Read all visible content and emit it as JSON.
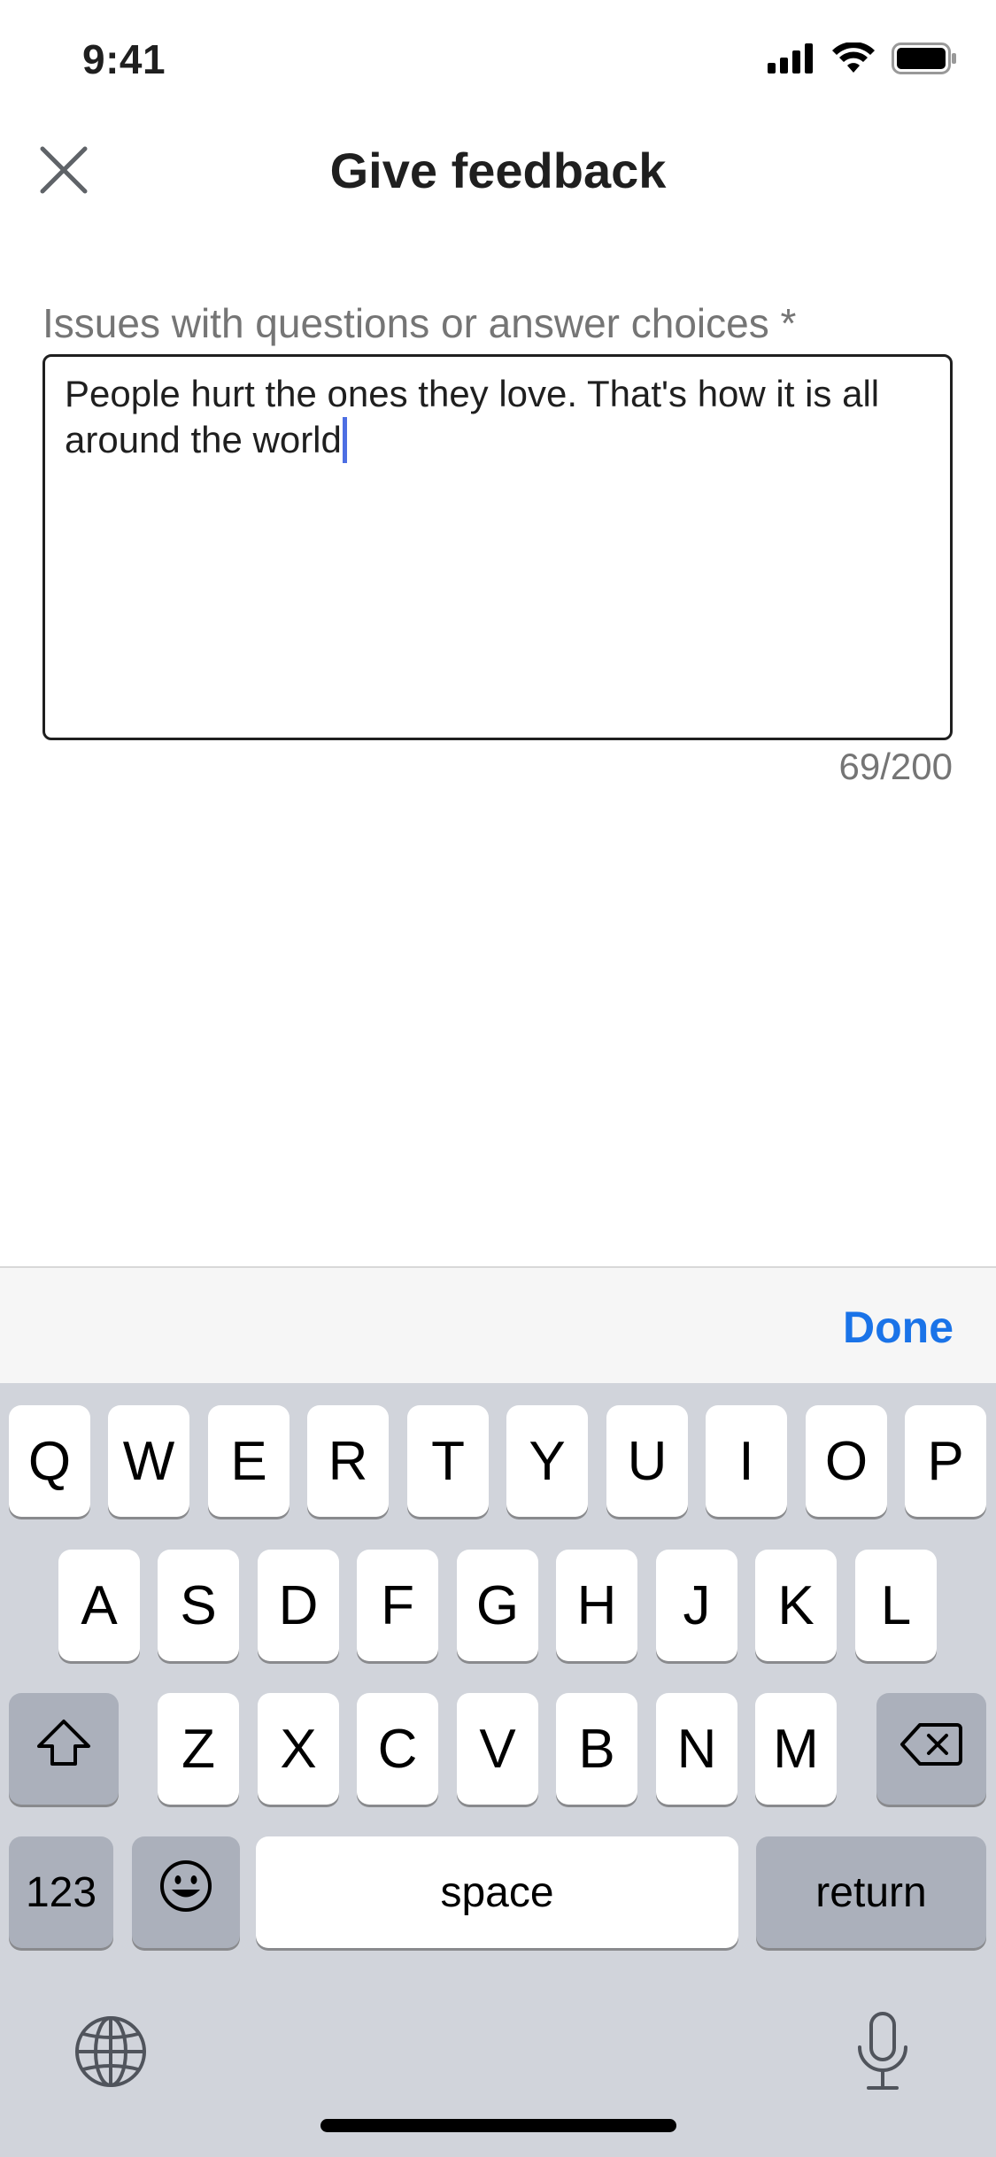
{
  "status_bar": {
    "time": "9:41"
  },
  "header": {
    "title": "Give feedback"
  },
  "form": {
    "label": "Issues with questions or answer choices *",
    "value": "People hurt the ones they love. That's how it is all around the world",
    "counter": "69/200"
  },
  "accessory": {
    "done_label": "Done"
  },
  "keyboard": {
    "row1": [
      "Q",
      "W",
      "E",
      "R",
      "T",
      "Y",
      "U",
      "I",
      "O",
      "P"
    ],
    "row2": [
      "A",
      "S",
      "D",
      "F",
      "G",
      "H",
      "J",
      "K",
      "L"
    ],
    "row3": [
      "Z",
      "X",
      "C",
      "V",
      "B",
      "N",
      "M"
    ],
    "numbers_label": "123",
    "space_label": "space",
    "return_label": "return"
  },
  "colors": {
    "accent": "#1a73e8",
    "caret": "#4d6ee3",
    "keyboard_bg": "#d1d4db",
    "dark_key": "#abb0bb"
  }
}
